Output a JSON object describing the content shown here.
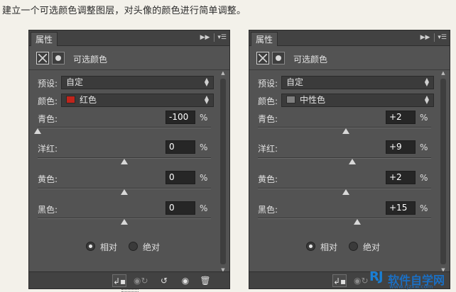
{
  "caption": "建立一个可选颜色调整图层，对头像的颜色进行简单调整。",
  "panels": [
    {
      "tab_label": "属性",
      "title": "可选颜色",
      "preset_label": "预设:",
      "preset_value": "自定",
      "colors_label": "颜色:",
      "colors_value": "红色",
      "swatch_color": "#c0241b",
      "sliders": [
        {
          "label": "青色:",
          "value": "-100",
          "unit": "%",
          "level": -100
        },
        {
          "label": "洋红:",
          "value": "0",
          "unit": "%",
          "level": 0
        },
        {
          "label": "黄色:",
          "value": "0",
          "unit": "%",
          "level": 0
        },
        {
          "label": "黑色:",
          "value": "0",
          "unit": "%",
          "level": 0
        }
      ],
      "radio_relative": "相对",
      "radio_absolute": "绝对",
      "selected": "relative"
    },
    {
      "tab_label": "属性",
      "title": "可选颜色",
      "preset_label": "预设:",
      "preset_value": "自定",
      "colors_label": "颜色:",
      "colors_value": "中性色",
      "swatch_color": "#7f7f7f",
      "sliders": [
        {
          "label": "青色:",
          "value": "+2",
          "unit": "%",
          "level": 2
        },
        {
          "label": "洋红:",
          "value": "+9",
          "unit": "%",
          "level": 9
        },
        {
          "label": "黄色:",
          "value": "+2",
          "unit": "%",
          "level": 2
        },
        {
          "label": "黑色:",
          "value": "+15",
          "unit": "%",
          "level": 15
        }
      ],
      "radio_relative": "相对",
      "radio_absolute": "绝对",
      "selected": "relative"
    }
  ],
  "icons": {
    "collapse": "double-arrow-icon",
    "menu": "panel-menu-icon",
    "clip": "clip-to-layer-icon",
    "view_previous": "view-previous-icon",
    "reset": "reset-icon",
    "visibility": "eye-icon",
    "delete": "trash-icon"
  },
  "watermark": {
    "logo": "RJ",
    "text": "软件自学网",
    "url": "www.rjzxw.com"
  }
}
